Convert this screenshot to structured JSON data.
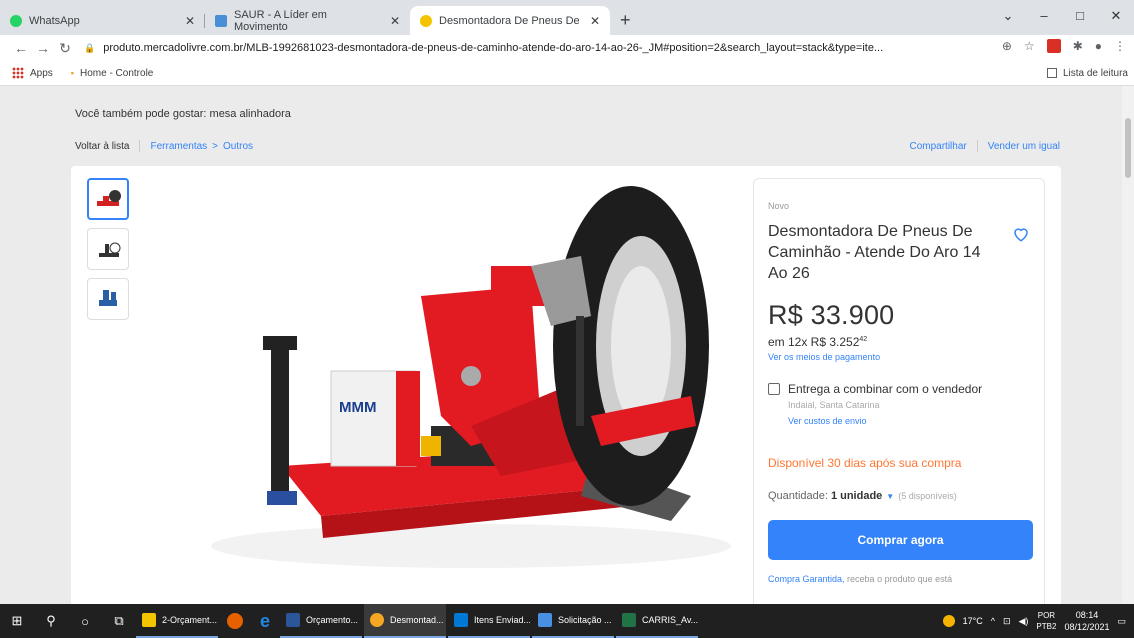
{
  "browser": {
    "tabs": [
      {
        "label": "WhatsApp",
        "color": "#25d366"
      },
      {
        "label": "SAUR - A Líder em Movimento",
        "color": "#4a8fd6"
      },
      {
        "label": "Desmontadora De Pneus De Car",
        "color": "#f5c400"
      }
    ],
    "new_tab": "+",
    "window": {
      "minimize": "–",
      "maximize": "□",
      "close": "✕",
      "dropdown": "⌄"
    },
    "url": "produto.mercadolivre.com.br/MLB-1992681023-desmontadora-de-pneus-de-caminho-atende-do-aro-14-ao-26-_JM#position=2&search_layout=stack&type=ite...",
    "bookmarks": {
      "apps": "Apps",
      "home": "Home - Controle",
      "reading_list": "Lista de leitura"
    }
  },
  "page": {
    "also_like": "Você também pode gostar: mesa alinhadora",
    "back": "Voltar à lista",
    "breadcrumb": [
      "Ferramentas",
      "Outros"
    ],
    "breadcrumb_sep": ">",
    "share": "Compartilhar",
    "sell_same": "Vender um igual"
  },
  "product": {
    "condition": "Novo",
    "title": "Desmontadora De Pneus De Caminhão - Atende Do Aro 14 Ao 26",
    "price": "R$ 33.900",
    "installments_prefix": "em 12x R$ 3.252",
    "installments_cents": "42",
    "payment_link": "Ver os meios de pagamento",
    "shipping": "Entrega a combinar com o vendedor",
    "location": "Indaial, Santa Catarina",
    "shipping_costs": "Ver custos de envio",
    "availability": "Disponível 30 dias após sua compra",
    "qty_label": "Quantidade:",
    "qty_value": "1 unidade",
    "stock": "(5 disponíveis)",
    "buy_button": "Comprar agora",
    "guarantee_link": "Compra Garantida,",
    "guarantee_text": " receba o produto que está"
  },
  "taskbar": {
    "apps": [
      {
        "label": "2-Orçament...",
        "color": "#f5c400"
      },
      {
        "label": "",
        "color": "#e66000"
      },
      {
        "label": "",
        "color": "#1e88e5"
      },
      {
        "label": "Orçamento...",
        "color": "#2b579a"
      },
      {
        "label": "Desmontad...",
        "color": "#f5a623"
      },
      {
        "label": "Itens Enviad...",
        "color": "#0078d4"
      },
      {
        "label": "Solicitação ...",
        "color": "#4a90e2"
      },
      {
        "label": "CARRIS_Av...",
        "color": "#217346"
      }
    ],
    "temp": "17°C",
    "lang": "POR",
    "lang2": "PTB2",
    "time": "08:14",
    "date": "08/12/2021"
  }
}
